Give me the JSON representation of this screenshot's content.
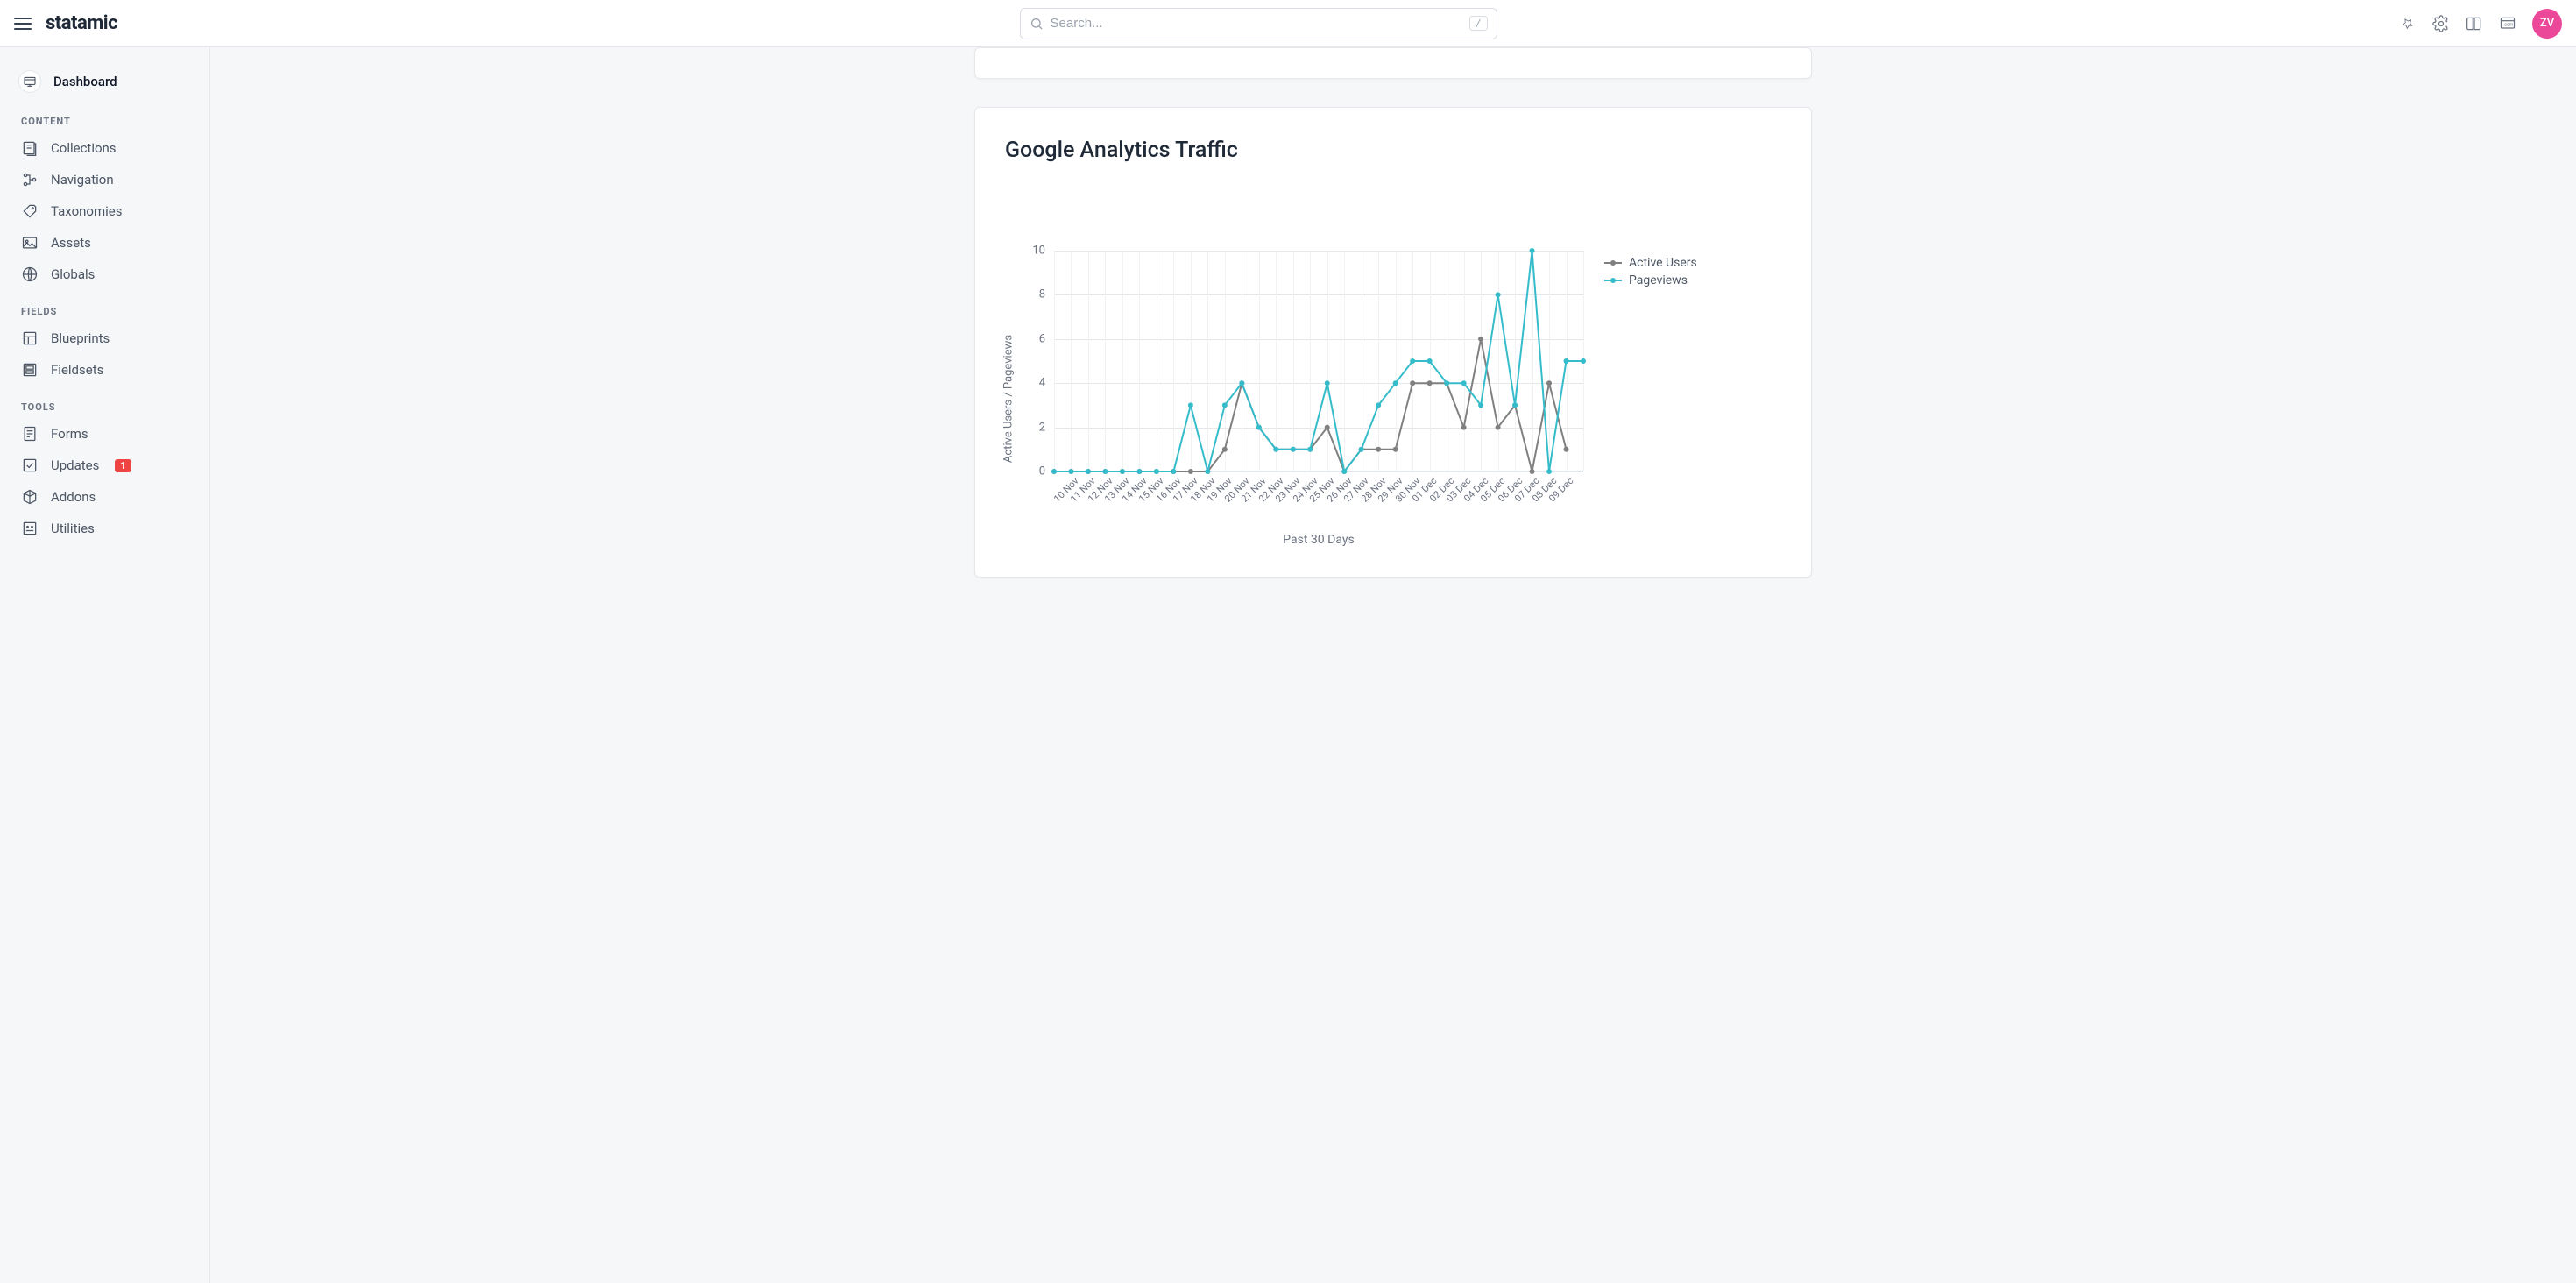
{
  "header": {
    "logo": "statamic",
    "search_placeholder": "Search...",
    "search_shortcut": "/",
    "avatar_initials": "ZV"
  },
  "sidebar": {
    "dashboard": "Dashboard",
    "sections": [
      {
        "title": "CONTENT",
        "items": [
          {
            "name": "collections",
            "label": "Collections"
          },
          {
            "name": "navigation",
            "label": "Navigation"
          },
          {
            "name": "taxonomies",
            "label": "Taxonomies"
          },
          {
            "name": "assets",
            "label": "Assets"
          },
          {
            "name": "globals",
            "label": "Globals"
          }
        ]
      },
      {
        "title": "FIELDS",
        "items": [
          {
            "name": "blueprints",
            "label": "Blueprints"
          },
          {
            "name": "fieldsets",
            "label": "Fieldsets"
          }
        ]
      },
      {
        "title": "TOOLS",
        "items": [
          {
            "name": "forms",
            "label": "Forms"
          },
          {
            "name": "updates",
            "label": "Updates",
            "badge": "1"
          },
          {
            "name": "addons",
            "label": "Addons"
          },
          {
            "name": "utilities",
            "label": "Utilities"
          }
        ]
      }
    ]
  },
  "card": {
    "title": "Google Analytics Traffic"
  },
  "chart_data": {
    "type": "line",
    "title": "Google Analytics Traffic",
    "xlabel": "Past 30 Days",
    "ylabel": "Active Users / Pageviews",
    "ylim": [
      0,
      10
    ],
    "yticks": [
      0,
      2,
      4,
      6,
      8,
      10
    ],
    "categories": [
      "10 Nov",
      "11 Nov",
      "12 Nov",
      "13 Nov",
      "14 Nov",
      "15 Nov",
      "16 Nov",
      "17 Nov",
      "18 Nov",
      "19 Nov",
      "20 Nov",
      "21 Nov",
      "22 Nov",
      "23 Nov",
      "24 Nov",
      "25 Nov",
      "26 Nov",
      "27 Nov",
      "28 Nov",
      "29 Nov",
      "30 Nov",
      "01 Dec",
      "02 Dec",
      "03 Dec",
      "04 Dec",
      "05 Dec",
      "06 Dec",
      "07 Dec",
      "08 Dec",
      "09 Dec"
    ],
    "series": [
      {
        "name": "Active Users",
        "color": "#808080",
        "values": [
          0,
          0,
          0,
          0,
          0,
          0,
          0,
          0,
          0,
          0,
          1,
          4,
          2,
          1,
          1,
          1,
          2,
          0,
          1,
          1,
          1,
          4,
          4,
          4,
          2,
          6,
          2,
          3,
          0,
          4,
          1
        ]
      },
      {
        "name": "Pageviews",
        "color": "#35bccb",
        "values": [
          0,
          0,
          0,
          0,
          0,
          0,
          0,
          0,
          3,
          0,
          3,
          4,
          2,
          1,
          1,
          1,
          4,
          0,
          1,
          3,
          4,
          5,
          5,
          4,
          4,
          3,
          8,
          3,
          10,
          0,
          5,
          5
        ]
      }
    ]
  }
}
